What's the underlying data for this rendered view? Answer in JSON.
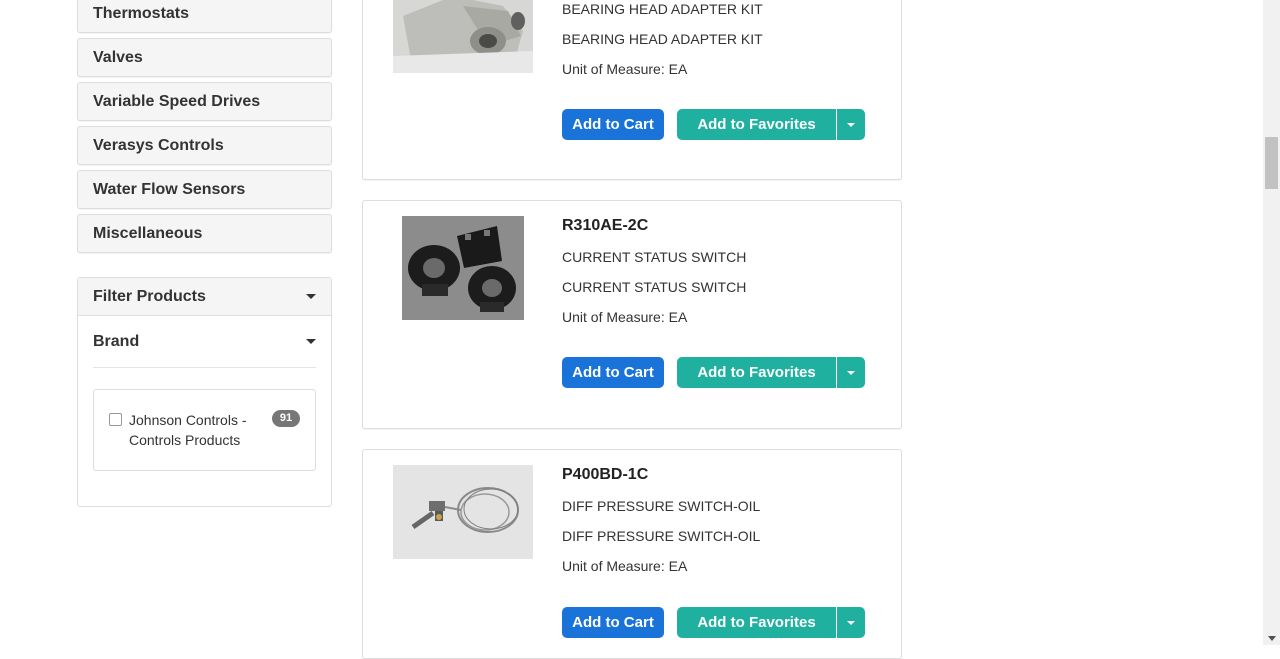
{
  "sidebar": {
    "categories": [
      {
        "label": "Thermostats"
      },
      {
        "label": "Valves"
      },
      {
        "label": "Variable Speed Drives"
      },
      {
        "label": "Verasys Controls"
      },
      {
        "label": "Water Flow Sensors"
      },
      {
        "label": "Miscellaneous"
      }
    ],
    "filter": {
      "title": "Filter Products",
      "brand_heading": "Brand",
      "brands": [
        {
          "label": "Johnson Controls - Controls Products",
          "count": "91",
          "checked": false
        }
      ]
    }
  },
  "products": [
    {
      "code": "",
      "desc1": "BEARING HEAD ADAPTER KIT",
      "desc2": "BEARING HEAD ADAPTER KIT",
      "uom": "Unit of Measure: EA",
      "image_icon": "bearing-head-adapter-photo"
    },
    {
      "code": "R310AE-2C",
      "desc1": "CURRENT STATUS SWITCH",
      "desc2": "CURRENT STATUS SWITCH",
      "uom": "Unit of Measure: EA",
      "image_icon": "current-switch-photo"
    },
    {
      "code": "P400BD-1C",
      "desc1": "DIFF PRESSURE SWITCH-OIL",
      "desc2": "DIFF PRESSURE SWITCH-OIL",
      "uom": "Unit of Measure: EA",
      "image_icon": "pressure-switch-photo"
    }
  ],
  "buttons": {
    "add_to_cart": "Add to Cart",
    "add_to_favorites": "Add to Favorites"
  },
  "colors": {
    "cart_button": "#1a73d9",
    "favorites_button": "#1fb0a0",
    "badge": "#777777"
  }
}
